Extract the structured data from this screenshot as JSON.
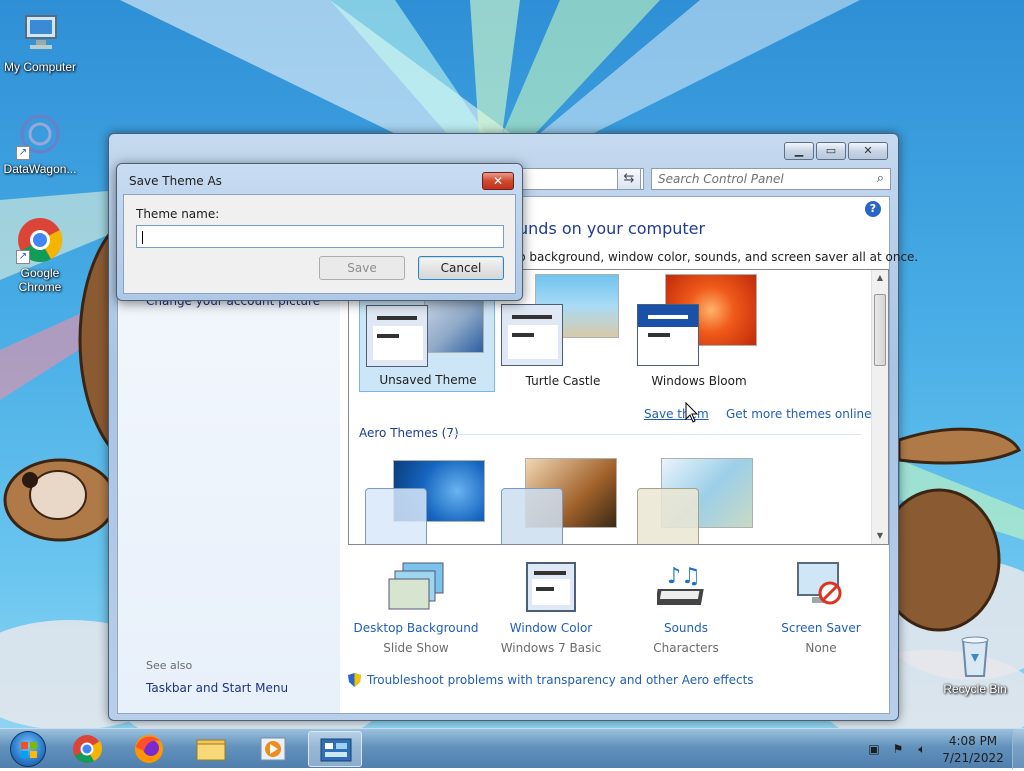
{
  "desktop": {
    "icons": [
      {
        "label": "My Computer"
      },
      {
        "label": "DataWagon..."
      },
      {
        "label": "Google Chrome"
      },
      {
        "label": "Recycle Bin"
      }
    ]
  },
  "window": {
    "search_placeholder": "Search Control Panel",
    "help_label": "?",
    "heading": "unds on your computer",
    "description": "p background, window color, sounds, and screen saver all at once.",
    "left_pane": {
      "partial_link": "Change your account picture",
      "see_also": "See also",
      "taskbar_link": "Taskbar and Start Menu"
    },
    "themes": {
      "my_themes": [
        {
          "name": "Unsaved Theme",
          "selected": true
        },
        {
          "name": "Turtle Castle",
          "selected": false
        },
        {
          "name": "Windows Bloom",
          "selected": false
        }
      ],
      "save_theme_link": "Save them",
      "more_themes_link": "Get more themes online",
      "aero_header": "Aero Themes (7)"
    },
    "bottom_items": [
      {
        "title": "Desktop Background",
        "sub": "Slide Show"
      },
      {
        "title": "Window Color",
        "sub": "Windows 7 Basic"
      },
      {
        "title": "Sounds",
        "sub": "Characters"
      },
      {
        "title": "Screen Saver",
        "sub": "None"
      }
    ],
    "troubleshoot_link": "Troubleshoot problems with transparency and other Aero effects"
  },
  "dialog": {
    "title": "Save Theme As",
    "label": "Theme name:",
    "input_value": "",
    "save_label": "Save",
    "cancel_label": "Cancel",
    "close_glyph": "✕"
  },
  "taskbar": {
    "clock_time": "4:08 PM",
    "clock_date": "7/21/2022"
  }
}
